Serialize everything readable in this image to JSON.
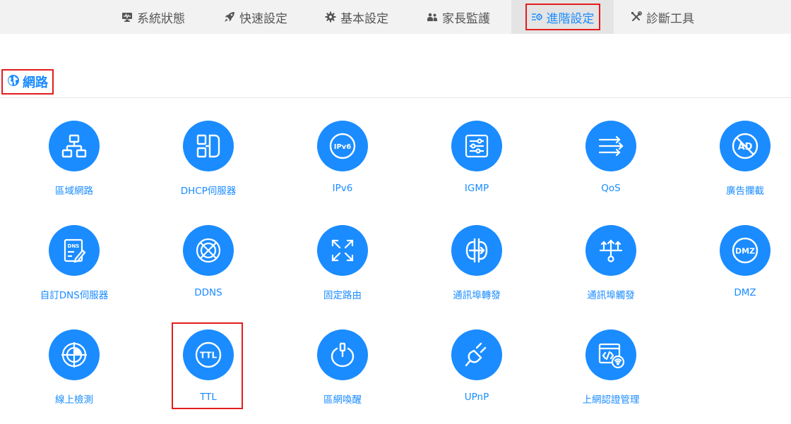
{
  "nav": {
    "items": [
      {
        "label": "系統狀態",
        "icon": "monitor-icon"
      },
      {
        "label": "快速設定",
        "icon": "rocket-icon"
      },
      {
        "label": "基本設定",
        "icon": "gear-icon"
      },
      {
        "label": "家長監護",
        "icon": "users-icon"
      },
      {
        "label": "進階設定",
        "icon": "sliders-gear-icon",
        "active": true
      },
      {
        "label": "診斷工具",
        "icon": "tools-icon"
      }
    ]
  },
  "section": {
    "title": "網路",
    "icon": "globe-icon"
  },
  "tiles": [
    {
      "label": "區域網路",
      "icon": "lan-icon"
    },
    {
      "label": "DHCP伺服器",
      "icon": "dhcp-icon"
    },
    {
      "label": "IPv6",
      "icon": "ipv6-icon"
    },
    {
      "label": "IGMP",
      "icon": "igmp-icon"
    },
    {
      "label": "QoS",
      "icon": "qos-icon"
    },
    {
      "label": "廣告攔截",
      "icon": "ad-block-icon"
    },
    {
      "label": "自訂DNS伺服器",
      "icon": "dns-icon"
    },
    {
      "label": "DDNS",
      "icon": "ddns-icon"
    },
    {
      "label": "固定路由",
      "icon": "static-route-icon"
    },
    {
      "label": "通訊埠轉發",
      "icon": "port-forward-icon"
    },
    {
      "label": "通訊埠觸發",
      "icon": "port-trigger-icon"
    },
    {
      "label": "DMZ",
      "icon": "dmz-icon"
    },
    {
      "label": "線上檢測",
      "icon": "online-check-icon"
    },
    {
      "label": "TTL",
      "icon": "ttl-icon"
    },
    {
      "label": "區網喚醒",
      "icon": "wake-on-lan-icon"
    },
    {
      "label": "UPnP",
      "icon": "upnp-icon"
    },
    {
      "label": "上網認證管理",
      "icon": "auth-management-icon"
    }
  ],
  "colors": {
    "accent": "#1a8cff",
    "highlight": "#e31d1d",
    "nav_bg": "#f2f2f2",
    "nav_text": "#555555"
  }
}
